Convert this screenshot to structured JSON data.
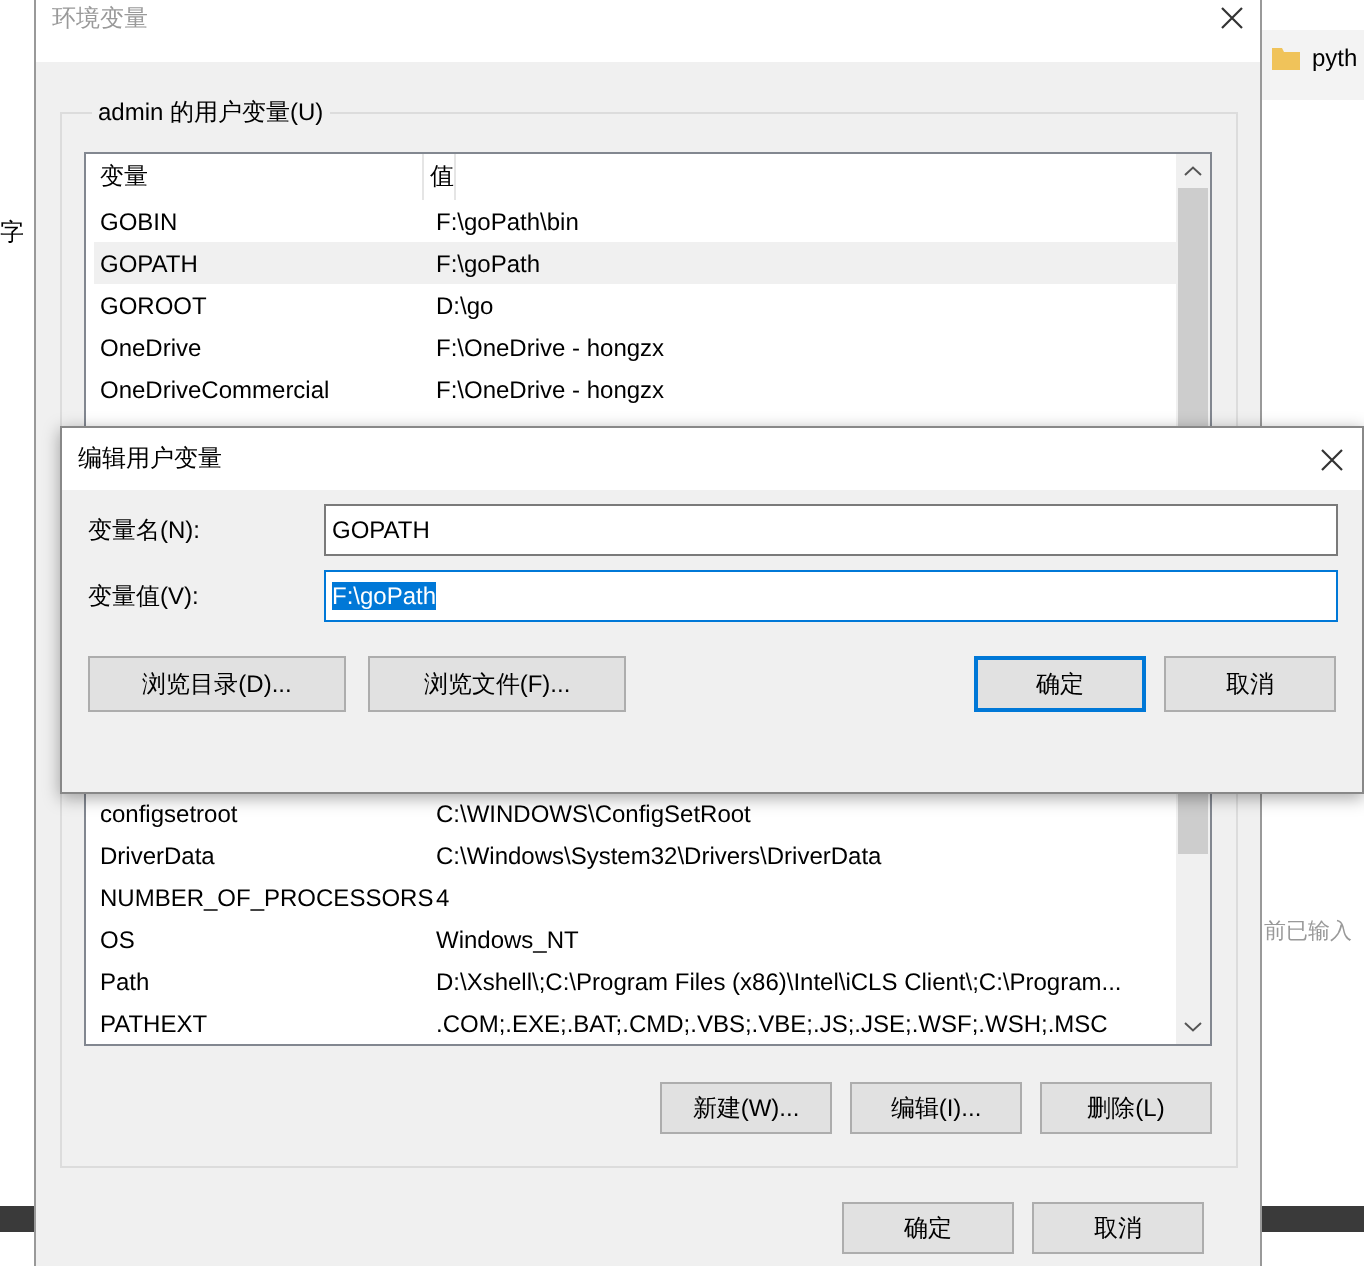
{
  "background_app": {
    "left_text": "字",
    "tab_text": "pyth",
    "hint_text": "前已输入"
  },
  "main_window": {
    "title": "环境变量",
    "group_label": "admin 的用户变量(U)",
    "columns": [
      "变量",
      "值"
    ],
    "rows_above": [
      {
        "name": "GOBIN",
        "value": "F:\\goPath\\bin",
        "selected": false
      },
      {
        "name": "GOPATH",
        "value": "F:\\goPath",
        "selected": true
      },
      {
        "name": "GOROOT",
        "value": "D:\\go",
        "selected": false
      },
      {
        "name": "OneDrive",
        "value": "F:\\OneDrive - hongzx",
        "selected": false
      },
      {
        "name": "OneDriveCommercial",
        "value": "F:\\OneDrive - hongzx",
        "selected": false
      }
    ],
    "rows_below": [
      {
        "name": "configsetroot",
        "value": "C:\\WINDOWS\\ConfigSetRoot",
        "selected": false
      },
      {
        "name": "DriverData",
        "value": "C:\\Windows\\System32\\Drivers\\DriverData",
        "selected": false
      },
      {
        "name": "NUMBER_OF_PROCESSORS",
        "value": "4",
        "selected": false
      },
      {
        "name": "OS",
        "value": "Windows_NT",
        "selected": false
      },
      {
        "name": "Path",
        "value": "D:\\Xshell\\;C:\\Program Files (x86)\\Intel\\iCLS Client\\;C:\\Program...",
        "selected": false
      },
      {
        "name": "PATHEXT",
        "value": ".COM;.EXE;.BAT;.CMD;.VBS;.VBE;.JS;.JSE;.WSF;.WSH;.MSC",
        "selected": false
      }
    ],
    "list_buttons": [
      "新建(W)...",
      "编辑(I)...",
      "删除(L)"
    ],
    "buttons": [
      "确定",
      "取消"
    ]
  },
  "edit_dialog": {
    "title": "编辑用户变量",
    "fields": [
      {
        "label": "变量名(N):",
        "value": "GOPATH",
        "focused": false
      },
      {
        "label": "变量值(V):",
        "value": "F:\\goPath",
        "focused": true
      }
    ],
    "left_buttons": [
      "浏览目录(D)...",
      "浏览文件(F)..."
    ],
    "right_buttons": [
      {
        "label": "确定",
        "default": true
      },
      {
        "label": "取消",
        "default": false
      }
    ]
  }
}
